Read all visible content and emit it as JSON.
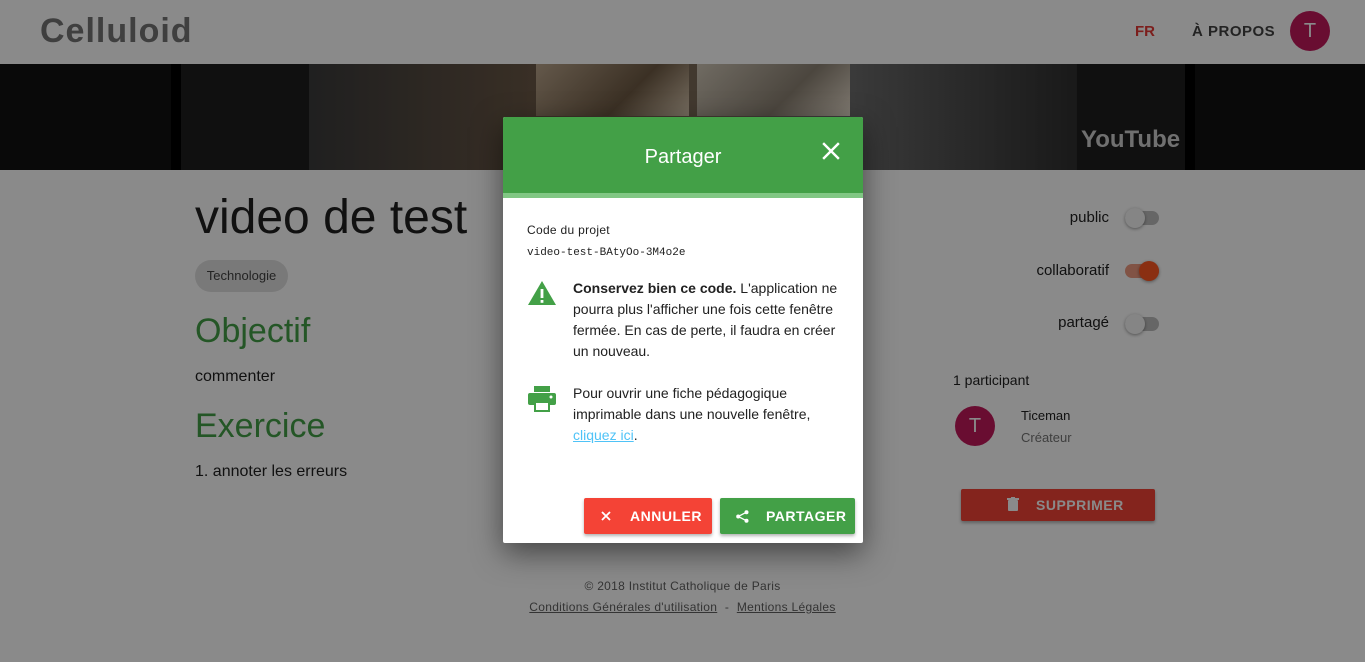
{
  "appbar": {
    "brand": "Celluloid",
    "lang": "FR",
    "about": "À PROPOS",
    "avatar_initial": "T"
  },
  "video": {
    "provider_logo": "YouTube"
  },
  "project": {
    "title": "video de test",
    "tag": "Technologie",
    "objective_heading": "Objectif",
    "objective_text": "commenter",
    "exercise_heading": "Exercice",
    "exercise_text": "1. annoter les erreurs"
  },
  "toggles": [
    {
      "label": "public",
      "on": false
    },
    {
      "label": "collaboratif",
      "on": true
    },
    {
      "label": "partagé",
      "on": false
    }
  ],
  "participants": {
    "count_label": "1 participant",
    "items": [
      {
        "initial": "T",
        "name": "Ticeman",
        "role": "Créateur"
      }
    ]
  },
  "delete_button": {
    "label": "SUPPRIMER",
    "icon": "trash-icon"
  },
  "footer": {
    "copyright": "© 2018 Institut Catholique de Paris",
    "link_terms": "Conditions Générales d'utilisation",
    "separator": "-",
    "link_legal": "Mentions Légales"
  },
  "dialog": {
    "title": "Partager",
    "close_icon": "close-icon",
    "code_label": "Code du projet",
    "code_value": "video-test-BAtyOo-3M4o2e",
    "warning_bold": "Conservez bien ce code.",
    "warning_text": " L'application ne pourra plus l'afficher une fois cette fenêtre fermée. En cas de perte, il faudra en créer un nouveau.",
    "warning_icon": "warning-icon",
    "print_text": "Pour ouvrir une fiche pédagogique imprimable dans une nouvelle fenêtre, ",
    "print_link": "cliquez ici",
    "print_end": ".",
    "print_icon": "printer-icon",
    "cancel_label": "ANNULER",
    "share_label": "PARTAGER"
  },
  "colors": {
    "primary_green": "#43a047",
    "accent_red": "#f44336",
    "toggle_on": "#ff5722",
    "avatar": "#c2185b",
    "link": "#4fc3f7"
  }
}
